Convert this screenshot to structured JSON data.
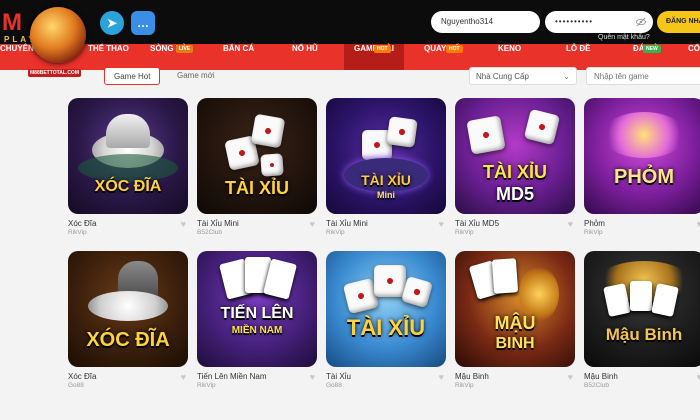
{
  "brand": {
    "logo_letter": "M",
    "logo_sub": "PLAY",
    "logo_site": "M88BETTOTAL.COM"
  },
  "header": {
    "username_value": "Nguyentho314",
    "password_value": "••••••••••",
    "forgot_label": "Quên mật khẩu?",
    "login_label": "ĐĂNG NHẬP"
  },
  "nav": {
    "items": [
      {
        "label": "CHUYÊN BÁ"
      },
      {
        "label": "THỂ THAO"
      },
      {
        "label": "SÒNG BÀI",
        "badge": "LIVE"
      },
      {
        "label": "BẮN CÁ"
      },
      {
        "label": "NỔ HŨ"
      },
      {
        "label": "GAME BÀI",
        "badge": "HOT"
      },
      {
        "label": "QUAY SỐ",
        "badge": "HOT"
      },
      {
        "label": "KENO"
      },
      {
        "label": "LÔ ĐỀ"
      },
      {
        "label": "ĐÁ GÀ",
        "badge": "NEW"
      },
      {
        "label": "CỔ"
      }
    ]
  },
  "filters": {
    "tab_hot": "Game Hot",
    "tab_new": "Game mới",
    "provider_select": "Nhà Cung Cấp",
    "search_placeholder": "Nhập tên game"
  },
  "games": [
    {
      "name": "Xóc Đĩa",
      "provider": "RikVip",
      "art_title": "XÓC ĐĨA"
    },
    {
      "name": "Tài Xỉu Mini",
      "provider": "B52Club",
      "art_title": "TÀI XỈU"
    },
    {
      "name": "Tài Xỉu Mini",
      "provider": "RikVip",
      "art_title": "TÀI XỈU",
      "art_sub": "Mini"
    },
    {
      "name": "Tài Xỉu MD5",
      "provider": "RikVip",
      "art_title": "TÀI XỈU",
      "art_sub": "MD5"
    },
    {
      "name": "Phỏm",
      "provider": "RikVip",
      "art_title": "PHỎM"
    },
    {
      "name": "Xóc Đĩa",
      "provider": "Go88",
      "art_title": "XÓC ĐĨA"
    },
    {
      "name": "Tiến Lên Miền Nam",
      "provider": "RikVip",
      "art_title": "TIẾN LÊN",
      "art_sub": "MIỀN NAM"
    },
    {
      "name": "Tài Xỉu",
      "provider": "Go88",
      "art_title": "TÀI XỈU"
    },
    {
      "name": "Mậu Binh",
      "provider": "RikVip",
      "art_title": "MẬU",
      "art_sub": "BINH"
    },
    {
      "name": "Mậu Binh",
      "provider": "B52Club",
      "art_title": "Mậu Binh"
    }
  ],
  "colors": {
    "nav_red": "#e8322a",
    "nav_active": "#b51d18",
    "login_yellow": "#f5c518",
    "topbar": "#0c0c0c"
  },
  "icons": {
    "telegram": "telegram-icon",
    "messenger": "chat-icon",
    "eye": "eye-off-icon",
    "heart": "heart-icon",
    "chevron": "chevron-down-icon"
  }
}
